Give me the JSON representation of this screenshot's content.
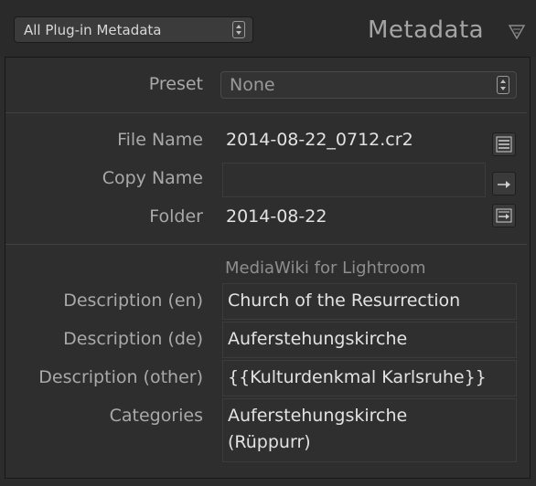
{
  "header": {
    "selector_label": "All Plug-in Metadata",
    "panel_title": "Metadata"
  },
  "preset": {
    "label": "Preset",
    "value": "None"
  },
  "fields": {
    "file_name": {
      "label": "File Name",
      "value": "2014-08-22_0712.cr2"
    },
    "copy_name": {
      "label": "Copy Name",
      "value": ""
    },
    "folder": {
      "label": "Folder",
      "value": "2014-08-22"
    }
  },
  "plugin_section": {
    "title": "MediaWiki for Lightroom",
    "description_en": {
      "label": "Description (en)",
      "value": "Church of the Resurrection"
    },
    "description_de": {
      "label": "Description (de)",
      "value": "Auferstehungskirche"
    },
    "description_other": {
      "label": "Description (other)",
      "value": "{{Kulturdenkmal Karlsruhe}}"
    },
    "categories": {
      "label": "Categories",
      "value_line1": "Auferstehungskirche",
      "value_line2": "(Rüppurr)"
    }
  },
  "icons": {
    "selector_stepper": "updown-arrows-icon",
    "collapse": "collapse-triangle-icon",
    "file_name_action": "list-icon",
    "copy_name_action": "go-arrow-icon",
    "folder_action": "go-to-folder-icon"
  }
}
